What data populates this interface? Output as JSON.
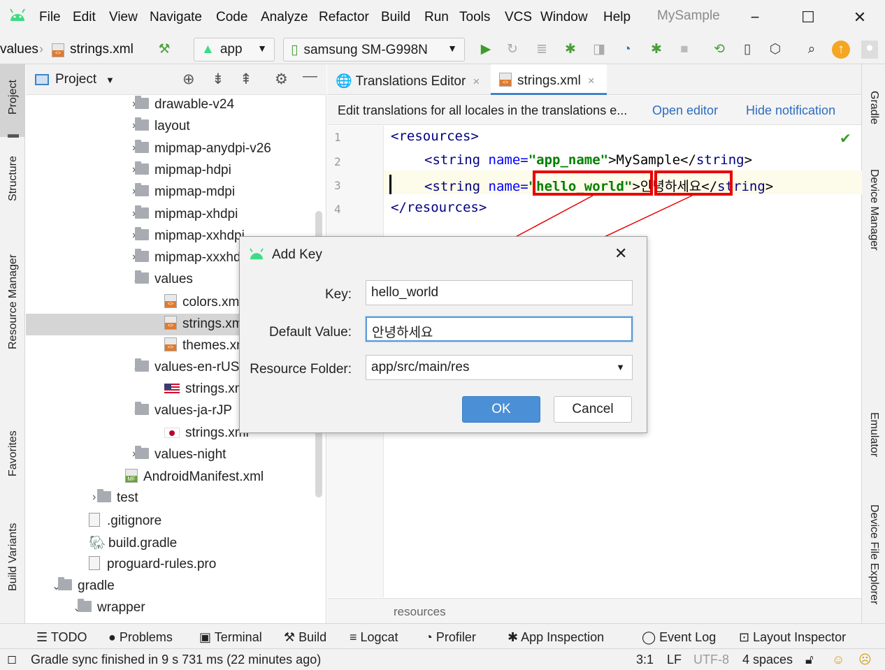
{
  "menu": {
    "items": [
      "File",
      "Edit",
      "View",
      "Navigate",
      "Code",
      "Analyze",
      "Refactor",
      "Build",
      "Run",
      "Tools",
      "VCS",
      "Window",
      "Help"
    ],
    "project_name": "MySample",
    "minimize": "−",
    "maximize": "☐",
    "close": "✕"
  },
  "navbar": {
    "crumb_values": "values",
    "crumb_file": "strings.xml",
    "run_config": "app",
    "device": "samsung SM-G998N"
  },
  "left_tabs": [
    "Project",
    "Structure",
    "Resource Manager",
    "Favorites",
    "Build Variants"
  ],
  "right_tabs": [
    "Gradle",
    "Device Manager",
    "Emulator",
    "Device File Explorer"
  ],
  "project_panel": {
    "title": "Project",
    "tree": [
      {
        "label": "drawable-v24",
        "type": "folder",
        "chev": "›"
      },
      {
        "label": "layout",
        "type": "folder",
        "chev": "›"
      },
      {
        "label": "mipmap-anydpi-v26",
        "type": "folder",
        "chev": "›"
      },
      {
        "label": "mipmap-hdpi",
        "type": "folder",
        "chev": "›"
      },
      {
        "label": "mipmap-mdpi",
        "type": "folder",
        "chev": "›"
      },
      {
        "label": "mipmap-xhdpi",
        "type": "folder",
        "chev": "›"
      },
      {
        "label": "mipmap-xxhdpi",
        "type": "folder",
        "chev": "›"
      },
      {
        "label": "mipmap-xxxhdpi",
        "type": "folder",
        "chev": "›"
      },
      {
        "label": "values",
        "type": "folder",
        "chev": "⌄"
      },
      {
        "label": "colors.xml",
        "type": "xml"
      },
      {
        "label": "strings.xml",
        "type": "xml"
      },
      {
        "label": "themes.xml",
        "type": "xml"
      },
      {
        "label": "values-en-rUS",
        "type": "folder",
        "chev": "⌄"
      },
      {
        "label": "strings.xml",
        "type": "flag-us"
      },
      {
        "label": "values-ja-rJP",
        "type": "folder",
        "chev": "⌄"
      },
      {
        "label": "strings.xml",
        "type": "flag-jp"
      },
      {
        "label": "values-night",
        "type": "folder",
        "chev": "›"
      },
      {
        "label": "AndroidManifest.xml",
        "type": "manifest"
      },
      {
        "label": "test",
        "type": "folder",
        "chev": "›"
      },
      {
        "label": ".gitignore",
        "type": "file"
      },
      {
        "label": "build.gradle",
        "type": "gradle"
      },
      {
        "label": "proguard-rules.pro",
        "type": "file"
      },
      {
        "label": "gradle",
        "type": "folder",
        "chev": "⌄"
      },
      {
        "label": "wrapper",
        "type": "folder",
        "chev": "⌄"
      }
    ]
  },
  "editor": {
    "tabs": [
      "Translations Editor",
      "strings.xml"
    ],
    "tab_close": "×",
    "notification": "Edit translations for all locales in the translations e...",
    "open_editor": "Open editor",
    "hide_notification": "Hide notification",
    "line_numbers": [
      "1",
      "2",
      "3",
      "4"
    ],
    "code": {
      "l1_tag": "<resources>",
      "l2_open": "<string",
      "l2_attr": " name=",
      "l2_val": "\"app_name\"",
      "l2_text": ">MySample</",
      "l2_close": "string",
      "l2_end": ">",
      "l3_open": "<string",
      "l3_attr": " name=",
      "l3_val": "\"hello_world\"",
      "l3_text": ">안녕하세요</",
      "l3_close": "string",
      "l3_end": ">",
      "l4_tag": "</resources>"
    },
    "breadcrumb": "resources"
  },
  "dialog": {
    "title": "Add Key",
    "close": "✕",
    "key_label": "Key:",
    "key_value": "hello_world",
    "default_label": "Default Value:",
    "default_value": "안녕하세요",
    "folder_label": "Resource Folder:",
    "folder_value": "app/src/main/res",
    "ok": "OK",
    "cancel": "Cancel"
  },
  "bottom_tools": [
    "TODO",
    "Problems",
    "Terminal",
    "Build",
    "Logcat",
    "Profiler",
    "App Inspection",
    "Event Log",
    "Layout Inspector"
  ],
  "status": {
    "message": "Gradle sync finished in 9 s 731 ms (22 minutes ago)",
    "position": "3:1",
    "line_sep": "LF",
    "encoding": "UTF-8",
    "indent": "4 spaces"
  },
  "colors": {
    "accent": "#4083c9",
    "annotation": "#e80000",
    "android_green": "#3ddc84"
  }
}
